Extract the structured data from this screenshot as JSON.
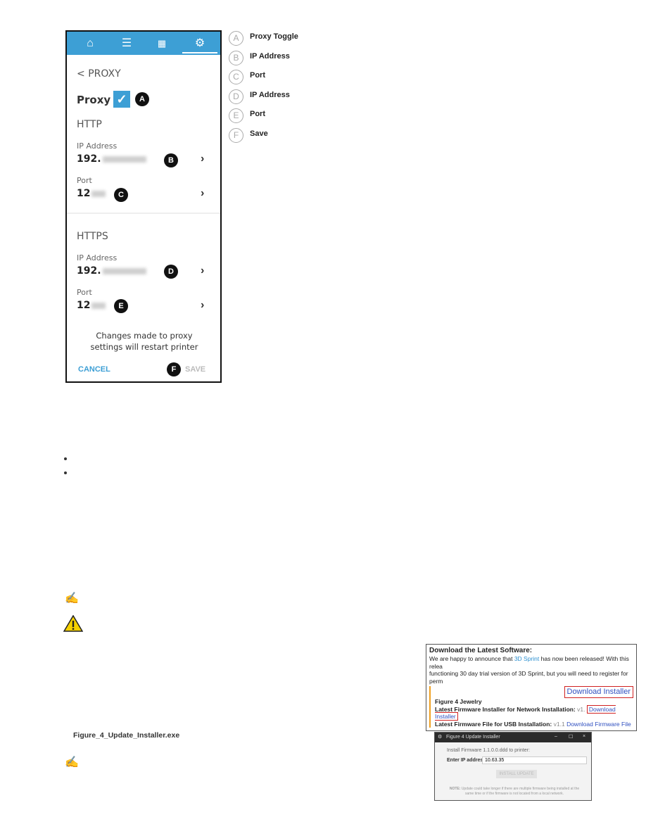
{
  "phone": {
    "nav_icons": [
      "home-icon",
      "menu-icon",
      "print-queue-icon",
      "gear-icon"
    ],
    "back_title": "PROXY",
    "proxy_label": "Proxy",
    "proxy_checked": true,
    "http": {
      "heading": "HTTP",
      "ip_label": "IP Address",
      "ip_value": "192.",
      "port_label": "Port",
      "port_value": "12"
    },
    "https": {
      "heading": "HTTPS",
      "ip_label": "IP Address",
      "ip_value": "192.",
      "port_label": "Port",
      "port_value": "12"
    },
    "notice": "Changes made to proxy settings will restart printer",
    "cancel": "CANCEL",
    "save": "SAVE",
    "accent": "#3d9fd5"
  },
  "callouts": [
    "A",
    "B",
    "C",
    "D",
    "E",
    "F"
  ],
  "legend": [
    {
      "letter": "A",
      "text": "Proxy Toggle"
    },
    {
      "letter": "B",
      "text": "IP Address"
    },
    {
      "letter": "C",
      "text": "Port"
    },
    {
      "letter": "D",
      "text": "IP Address"
    },
    {
      "letter": "E",
      "text": "Port"
    },
    {
      "letter": "F",
      "text": "Save"
    }
  ],
  "filename": "Figure_4_Update_Installer.exe",
  "download_shot": {
    "title": "Download the Latest Software:",
    "line1a": "We are happy to announce that ",
    "line1b": "3D Sprint",
    "line1c": " has now been released! With this relea",
    "line2": "functioning 30 day trial version of 3D Sprint, but you will need to register for perm",
    "product": "Figure 4 Jewelry",
    "net_label": "Latest Firmware Installer for Network Installation: ",
    "net_ver": "v1.",
    "usb_label": "Latest Firmware File for USB Installation: ",
    "usb_ver": "v1.1 ",
    "big_button": "Download Installer",
    "small_link": "Download Installer",
    "fw_link": "Download Firmware File"
  },
  "installer_shot": {
    "title": "Figure 4 Update Installer",
    "install_text": "Install Firmware 1.1.0.0.ddd to printer:",
    "ip_label": "Enter IP address",
    "ip_value": "10.63.35",
    "button": "INSTALL UPDATE",
    "note_label": "NOTE:",
    "note": "Update could take longer if there are multiple firmware being installed at the same time or if the firmware is not located from a local network."
  }
}
